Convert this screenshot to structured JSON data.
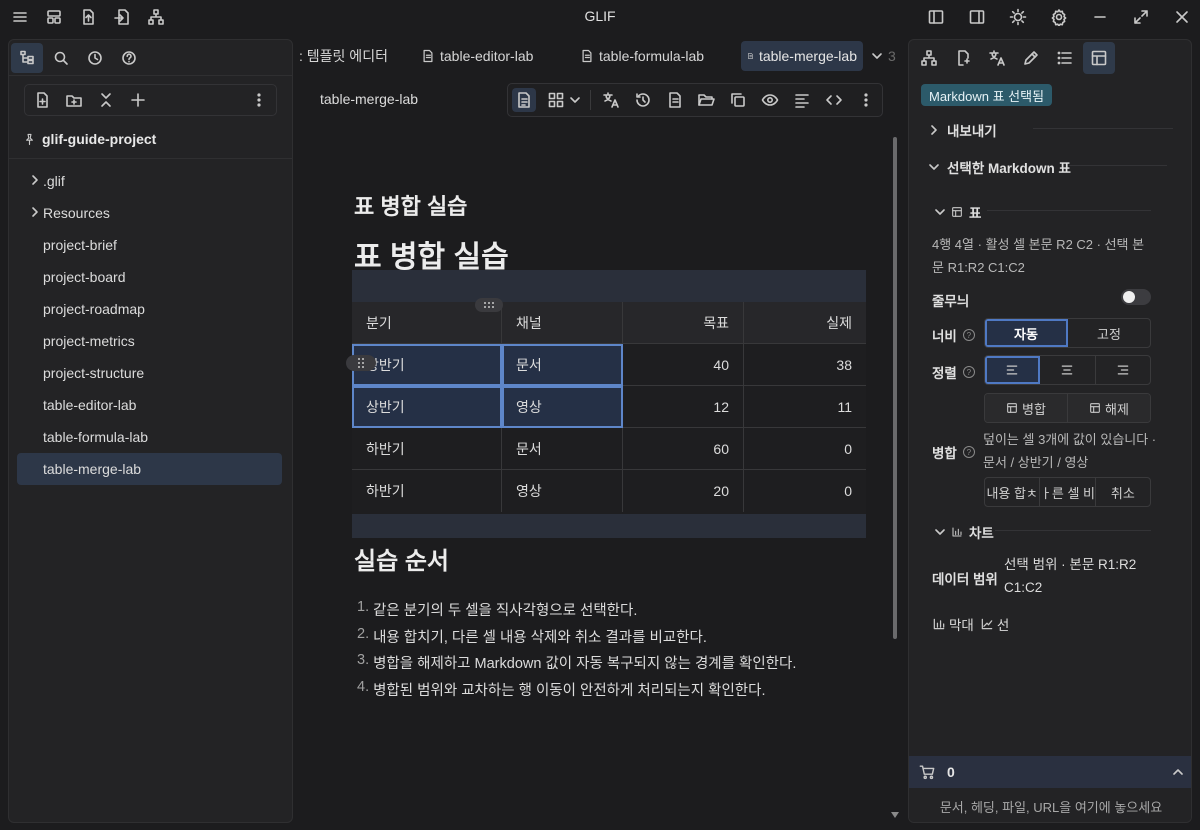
{
  "app": {
    "title": "GLIF"
  },
  "left_sidebar": {
    "project_name": "glif-guide-project",
    "tree": [
      {
        "label": ".glif",
        "type": "folder"
      },
      {
        "label": "Resources",
        "type": "folder"
      },
      {
        "label": "project-brief",
        "type": "file"
      },
      {
        "label": "project-board",
        "type": "file"
      },
      {
        "label": "project-roadmap",
        "type": "file"
      },
      {
        "label": "project-metrics",
        "type": "file"
      },
      {
        "label": "project-structure",
        "type": "file"
      },
      {
        "label": "table-editor-lab",
        "type": "file"
      },
      {
        "label": "table-formula-lab",
        "type": "file"
      },
      {
        "label": "table-merge-lab",
        "type": "file",
        "active": true
      }
    ]
  },
  "tabs": [
    {
      "label": ": 템플릿 에디터"
    },
    {
      "label": "table-editor-lab"
    },
    {
      "label": "table-formula-lab"
    },
    {
      "label": "table-merge-lab",
      "active": true
    },
    {
      "label": "3"
    }
  ],
  "editor": {
    "doc_title": "table-merge-lab",
    "heading2": "표 병합 실습",
    "heading1": "표 병합 실습",
    "table": {
      "headers": [
        "분기",
        "채널",
        "목표",
        "실제"
      ],
      "rows": [
        [
          "상반기",
          "문서",
          "40",
          "38"
        ],
        [
          "상반기",
          "영상",
          "12",
          "11"
        ],
        [
          "하반기",
          "문서",
          "60",
          "0"
        ],
        [
          "하반기",
          "영상",
          "20",
          "0"
        ]
      ]
    },
    "steps_heading": "실습 순서",
    "steps": [
      "같은 분기의 두 셀을 직사각형으로 선택한다.",
      "내용 합치기, 다른 셀 내용 삭제와 취소 결과를 비교한다.",
      "병합을 해제하고 Markdown 값이 자동 복구되지 않는 경계를 확인한다.",
      "병합된 범위와 교차하는 행 이동이 안전하게 처리되는지 확인한다."
    ]
  },
  "right_panel": {
    "badge": "Markdown 표 선택됨",
    "export_label": "내보내기",
    "selected_table_label": "선택한 Markdown 표",
    "table_section": "표",
    "table_info": "4행 4열 · 활성 셀 본문 R2 C2 · 선택 본문 R1:R2 C1:C2",
    "stripes_label": "줄무늬",
    "width_label": "너비",
    "width_options": [
      "자동",
      "고정"
    ],
    "align_label": "정렬",
    "merge_label": "병합",
    "merge_buttons": [
      "병합",
      "해제"
    ],
    "merge_note": "덮이는 셀 3개에 값이 있습니다 · 문서 / 상반기 / 영상",
    "merge_actions": [
      "내용 합ㅊ",
      "ㅏ른 셀 비",
      "취소"
    ],
    "chart_section": "차트",
    "data_range_label": "데이터 범위",
    "data_range_value": "선택 범위 · 본문 R1:R2 C1:C2",
    "chart_types": [
      "막대",
      "선"
    ],
    "cart_count": "0",
    "drop_hint": "문서, 헤딩, 파일, URL을 여기에 놓으세요"
  },
  "colors": {
    "accent": "#5e86c9",
    "selection": "#253046",
    "badge": "#2c5a6a"
  }
}
